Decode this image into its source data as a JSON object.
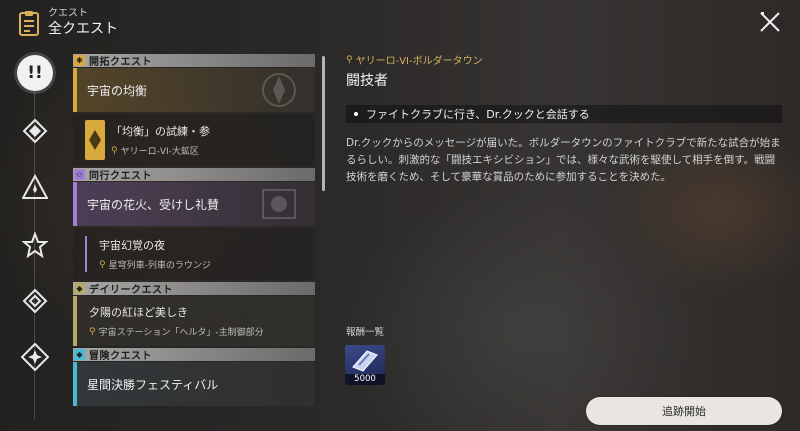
{
  "header": {
    "sub": "クエスト",
    "title": "全クエスト"
  },
  "colors": {
    "trailblaze": "#d9a93d",
    "companion": "#a27fd6",
    "daily": "#b7a96a",
    "adventure": "#48b9d1",
    "accent": "#d7b25e"
  },
  "rail": {
    "icons": [
      "exclamation-icon",
      "trailblaze-diamond-icon",
      "triangle-star-icon",
      "star-icon",
      "diamond-icon",
      "diamond-star-icon"
    ]
  },
  "categories": [
    {
      "label": "開拓クエスト",
      "icon": "trailblaze-icon",
      "quests": [
        {
          "title": "宇宙の均衡"
        }
      ],
      "sub": {
        "title": "「均衡」の試練・参",
        "location": "ヤリーロ-VI-大鉱区"
      }
    },
    {
      "label": "同行クエスト",
      "icon": "companion-icon",
      "quests": [
        {
          "title": "宇宙の花火、受けし礼賛"
        }
      ],
      "sub": {
        "title": "宇宙幻覚の夜",
        "location": "星穹列車-列車のラウンジ"
      }
    },
    {
      "label": "デイリークエスト",
      "icon": "daily-icon",
      "quests": [
        {
          "title": "夕陽の紅ほど美しき",
          "location": "宇宙ステーション「ヘルタ」-主制御部分"
        }
      ]
    },
    {
      "label": "冒険クエスト",
      "icon": "adventure-icon",
      "quests": [
        {
          "title": "星間決勝フェスティバル"
        }
      ]
    }
  ],
  "detail": {
    "location": "ヤリーロ-VI-ボルダータウン",
    "title": "闘技者",
    "objective": "ファイトクラブに行き、Dr.クックと会話する",
    "description": "Dr.クックからのメッセージが届いた。ボルダータウンのファイトクラブで新たな試合が始まるらしい。刺激的な「闘技エキシビション」では、様々な武術を駆使して相手を倒す。戦闘技術を磨くため、そして豪華な賞品のために参加することを決めた。",
    "rewards_label": "報酬一覧",
    "rewards": [
      {
        "icon": "credit-chip-icon",
        "count": "5000"
      }
    ],
    "track_button": "追跡開始"
  }
}
